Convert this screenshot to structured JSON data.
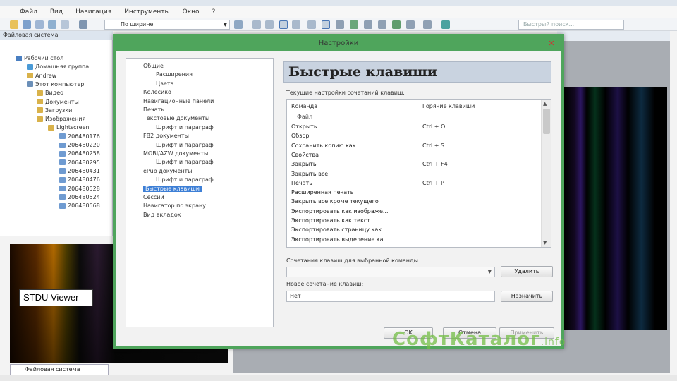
{
  "app": {
    "title": "STDU Viewer",
    "menu": [
      "Файл",
      "Вид",
      "Навигация",
      "Инструменты",
      "Окно",
      "?"
    ],
    "zoom_mode": "По ширине",
    "quick_search_placeholder": "Быстрый поиск...",
    "left_panel_title": "Файловая система",
    "tree": [
      "Рабочий стол",
      "Домашняя группа",
      "Andrew",
      "Этот компьютер",
      "Видео",
      "Документы",
      "Загрузки",
      "Изображения",
      "Lightscreen",
      "206480176",
      "206480220",
      "206480258",
      "206480295",
      "206480431",
      "206480476",
      "206480528",
      "206480524",
      "206480568"
    ],
    "file_system_tab": "Файловая система",
    "watermark": {
      "main": "СофтКаталог",
      "suffix": ".info"
    },
    "colors": {
      "dialog_border": "#4fa55c",
      "selection": "#3d7fd6",
      "watermark": "#73be46"
    }
  },
  "dialog": {
    "title": "Настройки",
    "close_icon": "close-icon",
    "tree": [
      {
        "label": "Общие",
        "level": 0
      },
      {
        "label": "Расширения",
        "level": 1
      },
      {
        "label": "Цвета",
        "level": 1
      },
      {
        "label": "Колесико",
        "level": 0
      },
      {
        "label": "Навигационные панели",
        "level": 0
      },
      {
        "label": "Печать",
        "level": 0
      },
      {
        "label": "Текстовые документы",
        "level": 0
      },
      {
        "label": "Шрифт и параграф",
        "level": 1
      },
      {
        "label": "FB2 документы",
        "level": 0
      },
      {
        "label": "Шрифт и параграф",
        "level": 1
      },
      {
        "label": "MOBI/AZW документы",
        "level": 0
      },
      {
        "label": "Шрифт и параграф",
        "level": 1
      },
      {
        "label": "ePub документы",
        "level": 0
      },
      {
        "label": "Шрифт и параграф",
        "level": 1
      },
      {
        "label": "Быстрые клавиши",
        "level": 0,
        "selected": true
      },
      {
        "label": "Сессии",
        "level": 0
      },
      {
        "label": "Навигатор по экрану",
        "level": 0
      },
      {
        "label": "Вид вкладок",
        "level": 0
      }
    ],
    "section_title": "Быстрые клавиши",
    "current_settings_label": "Текущие настройки сочетаний клавиш:",
    "table": {
      "col_command": "Команда",
      "col_hotkeys": "Горячие клавиши",
      "group": "Файл",
      "rows": [
        {
          "command": "Открыть",
          "keys": "Ctrl + O"
        },
        {
          "command": "Обзор",
          "keys": ""
        },
        {
          "command": "Сохранить копию как...",
          "keys": "Ctrl + S"
        },
        {
          "command": "Свойства",
          "keys": ""
        },
        {
          "command": "Закрыть",
          "keys": "Ctrl + F4"
        },
        {
          "command": "Закрыть все",
          "keys": ""
        },
        {
          "command": "Печать",
          "keys": "Ctrl + P"
        },
        {
          "command": "Расширенная печать",
          "keys": ""
        },
        {
          "command": "Закрыть все кроме текущего",
          "keys": ""
        },
        {
          "command": "Экспортировать как изображе...",
          "keys": ""
        },
        {
          "command": "Экспортировать как текст",
          "keys": ""
        },
        {
          "command": "Экспортировать страницу как ...",
          "keys": ""
        },
        {
          "command": "Экспортировать выделение ка...",
          "keys": ""
        }
      ]
    },
    "combo_label": "Сочетания клавиш для выбранной команды:",
    "delete_button": "Удалить",
    "new_combo_label": "Новое сочетание клавиш:",
    "new_combo_value": "Нет",
    "assign_button": "Назначить",
    "ok_button": "OK",
    "cancel_button": "Отмена",
    "apply_button": "Применить"
  }
}
